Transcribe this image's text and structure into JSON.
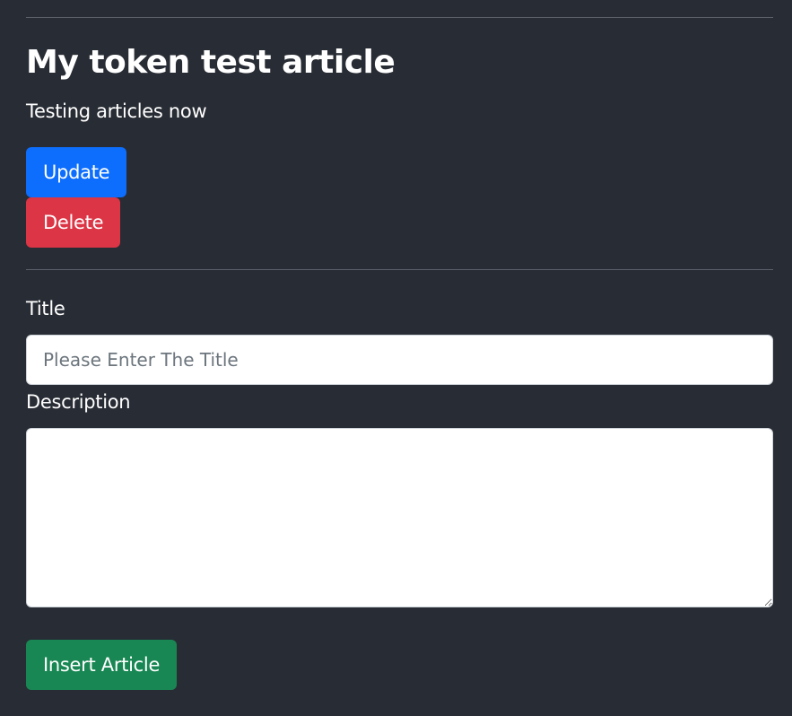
{
  "article": {
    "title": "My token test article",
    "description": "Testing articles now",
    "update_label": "Update",
    "delete_label": "Delete"
  },
  "form": {
    "title_label": "Title",
    "title_placeholder": "Please Enter The Title",
    "title_value": "",
    "description_label": "Description",
    "description_value": "",
    "submit_label": "Insert Article"
  },
  "colors": {
    "background": "#282c34",
    "update_button": "#0d6efd",
    "delete_button": "#dc3545",
    "insert_button": "#198754"
  }
}
